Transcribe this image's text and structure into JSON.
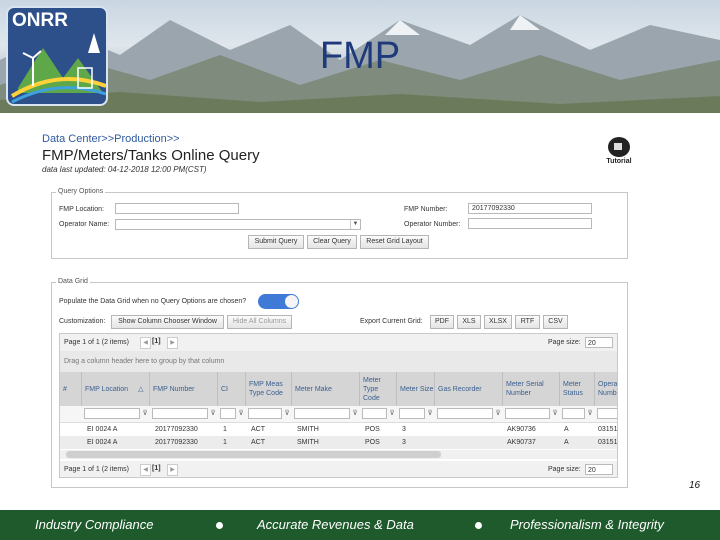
{
  "slide": {
    "title": "FMP",
    "logo_text": "ONRR",
    "slide_number": "16"
  },
  "page": {
    "breadcrumb": "Data Center>>Production>>",
    "heading": "FMP/Meters/Tanks Online Query",
    "last_updated": "data last updated: 04-12-2018 12:00 PM(CST)",
    "tutorial_label": "Tutorial"
  },
  "query": {
    "legend": "Query Options",
    "fmp_location_label": "FMP Location:",
    "fmp_location_value": "",
    "operator_name_label": "Operator Name:",
    "operator_name_value": "",
    "fmp_number_label": "FMP Number:",
    "fmp_number_value": "20177092330",
    "operator_number_label": "Operator Number:",
    "operator_number_value": "",
    "submit_label": "Submit Query",
    "clear_label": "Clear Query",
    "reset_label": "Reset Grid Layout"
  },
  "datagrid": {
    "legend": "Data Grid",
    "populate_label": "Populate the Data Grid when no Query Options are chosen?",
    "populate_on": true,
    "customization_label": "Customization:",
    "show_chooser_label": "Show Column Chooser Window",
    "hide_all_label": "Hide All Columns",
    "export_label": "Export Current Grid:",
    "export_buttons": [
      "PDF",
      "XLS",
      "XLSX",
      "RTF",
      "CSV"
    ],
    "pager_text": "Page 1 of 1 (2 items)",
    "pager_current": "[1]",
    "page_size_label": "Page size:",
    "page_size_value": "20",
    "group_hint": "Drag a column header here to group by that column",
    "columns": [
      "#",
      "FMP Location",
      "FMP Number",
      "CI",
      "FMP Meas Type Code",
      "Meter Make",
      "Meter Type Code",
      "Meter Size",
      "Gas Recorder",
      "Meter Serial Number",
      "Meter Status",
      "Opera Numb"
    ],
    "sort_indicator": "△",
    "rows": [
      [
        "",
        "EI 0024 A",
        "20177092330",
        "1",
        "ACT",
        "SMITH",
        "POS",
        "3",
        "",
        "AK90736",
        "A",
        "03151"
      ],
      [
        "",
        "EI 0024 A",
        "20177092330",
        "1",
        "ACT",
        "SMITH",
        "POS",
        "3",
        "",
        "AK90737",
        "A",
        "03151"
      ]
    ]
  },
  "footer": {
    "items": [
      "Industry Compliance",
      "Accurate Revenues & Data",
      "Professionalism & Integrity"
    ]
  },
  "colors": {
    "footer_bg": "#1e5a2b",
    "title": "#1f3a7a",
    "toggle_on": "#3f7bd6",
    "link": "#2f5a9c"
  }
}
